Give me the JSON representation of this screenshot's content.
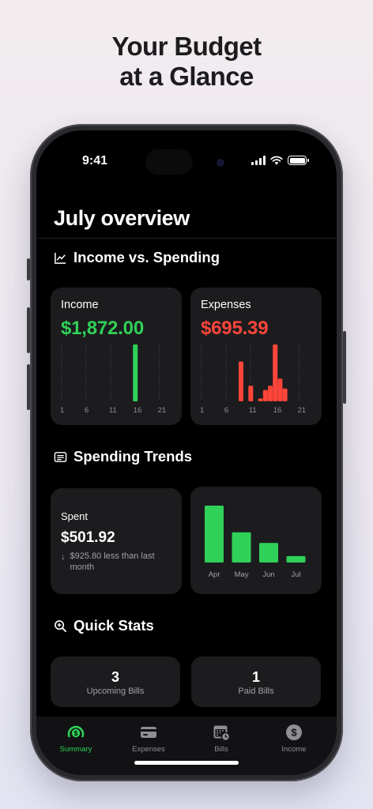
{
  "headline": {
    "line1": "Your Budget",
    "line2": "at a Glance"
  },
  "status_bar": {
    "time": "9:41"
  },
  "page_title": "July overview",
  "sections": {
    "income_vs_spending": "Income vs. Spending",
    "spending_trends": "Spending Trends",
    "quick_stats": "Quick Stats"
  },
  "income_card": {
    "label": "Income",
    "amount": "$1,872.00",
    "color": "#30d158",
    "x_ticks": [
      "1",
      "6",
      "11",
      "16",
      "21"
    ]
  },
  "expenses_card": {
    "label": "Expenses",
    "amount": "$695.39",
    "color": "#ff453a",
    "x_ticks": [
      "1",
      "6",
      "11",
      "16",
      "21"
    ]
  },
  "spent_card": {
    "label": "Spent",
    "value": "$501.92",
    "arrow": "↓",
    "note": "$925.80 less than last month"
  },
  "quick_stats": [
    {
      "value": "3",
      "label": "Upcoming Bills"
    },
    {
      "value": "1",
      "label": "Paid Bills"
    }
  ],
  "tabs": [
    {
      "label": "Summary",
      "icon": "summary-gauge-icon",
      "active": true
    },
    {
      "label": "Expenses",
      "icon": "credit-card-icon",
      "active": false
    },
    {
      "label": "Bills",
      "icon": "calendar-clock-icon",
      "active": false
    },
    {
      "label": "Income",
      "icon": "dollar-circle-icon",
      "active": false
    }
  ],
  "colors": {
    "accent_green": "#30d158",
    "accent_red": "#ff453a",
    "card_bg": "#1c1c1e"
  },
  "chart_data": [
    {
      "type": "bar",
      "x": [
        16
      ],
      "values": [
        1872.0
      ],
      "xticks": [
        "1",
        "6",
        "11",
        "16",
        "21"
      ],
      "xlim": [
        1,
        23
      ]
    },
    {
      "type": "bar",
      "x": [
        9,
        11,
        13,
        14,
        15,
        16,
        17,
        18
      ],
      "values": [
        140,
        55,
        10,
        40,
        55,
        200,
        80,
        45
      ],
      "xticks": [
        "1",
        "6",
        "11",
        "16",
        "21"
      ],
      "xlim": [
        1,
        23
      ]
    },
    {
      "type": "bar",
      "categories": [
        "Apr",
        "May",
        "Jun",
        "Jul"
      ],
      "values": [
        1427.72,
        758.1,
        491.9,
        160.4
      ]
    }
  ]
}
